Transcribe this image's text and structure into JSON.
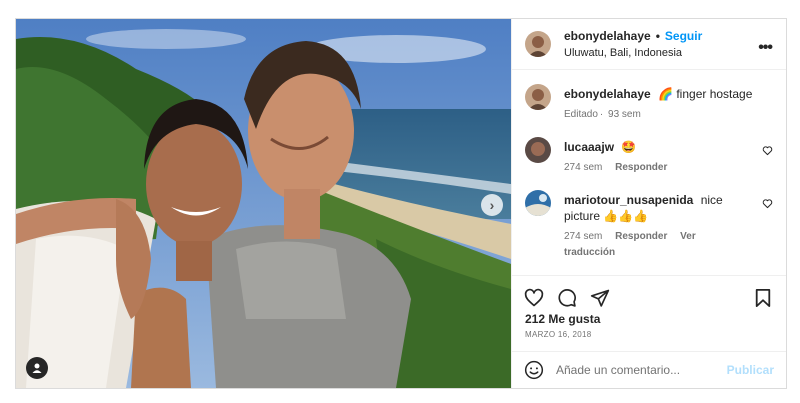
{
  "header": {
    "username": "ebonydelahaye",
    "separator": "•",
    "follow_label": "Seguir",
    "location": "Uluwatu, Bali, Indonesia",
    "more_icon": "more-options-icon"
  },
  "caption": {
    "username": "ebonydelahaye",
    "emoji": "🌈",
    "text": "finger hostage",
    "meta_edited": "Editado",
    "meta_time": "93 sem"
  },
  "comments": [
    {
      "username": "lucaaajw",
      "text": "🤩",
      "time": "274 sem",
      "reply_label": "Responder"
    },
    {
      "username": "mariotour_nusapenida",
      "text": "nice picture 👍👍👍",
      "time": "274 sem",
      "reply_label": "Responder",
      "translate_label": "Ver traducción"
    }
  ],
  "likes": "212 Me gusta",
  "date": "MARZO 16, 2018",
  "comment_input": {
    "placeholder": "Añade un comentario..."
  },
  "publish_label": "Publicar",
  "colors": {
    "accent": "#0095f6",
    "publish_disabled": "#b2dffc",
    "muted": "#737373"
  }
}
